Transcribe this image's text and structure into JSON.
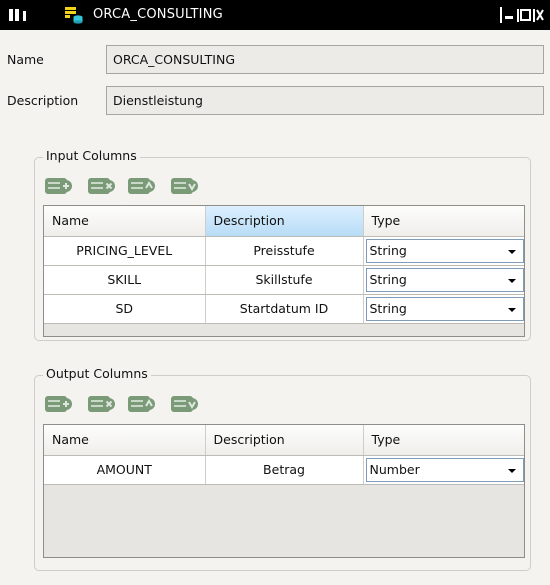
{
  "window": {
    "title": "ORCA_CONSULTING",
    "app_icon": "app-logo-icon",
    "title_icon": "database-table-icon"
  },
  "form": {
    "name_label": "Name",
    "name_value": "ORCA_CONSULTING",
    "description_label": "Description",
    "description_value": "Dienstleistung"
  },
  "input_columns": {
    "title": "Input Columns",
    "toolbar_icons": [
      "add-column-icon",
      "delete-column-icon",
      "move-up-icon",
      "move-down-icon"
    ],
    "headers": {
      "name": "Name",
      "description": "Description",
      "type": "Type"
    },
    "rows": [
      {
        "name": "PRICING_LEVEL",
        "description": "Preisstufe",
        "type": "String"
      },
      {
        "name": "SKILL",
        "description": "Skillstufe",
        "type": "String"
      },
      {
        "name": "SD",
        "description": "Startdatum ID",
        "type": "String"
      }
    ]
  },
  "output_columns": {
    "title": "Output Columns",
    "toolbar_icons": [
      "add-column-icon",
      "delete-column-icon",
      "move-up-icon",
      "move-down-icon"
    ],
    "headers": {
      "name": "Name",
      "description": "Description",
      "type": "Type"
    },
    "rows": [
      {
        "name": "AMOUNT",
        "description": "Betrag",
        "type": "Number"
      }
    ]
  },
  "colors": {
    "titlebar_bg": "#000000",
    "window_bg": "#f4f3f0",
    "selected_header": "#b8dcf6",
    "icon_green": "#7a9a78",
    "icon_yellow": "#f2d21b",
    "icon_cyan": "#35c4d8"
  }
}
